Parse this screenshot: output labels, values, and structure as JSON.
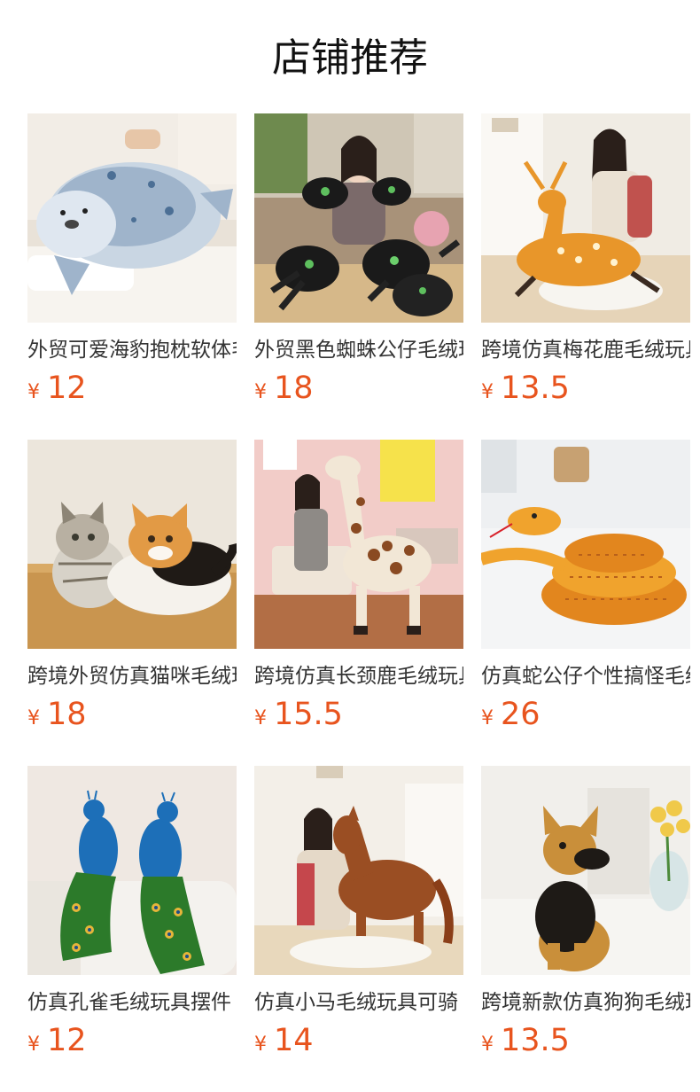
{
  "section": {
    "title": "店铺推荐"
  },
  "products": [
    {
      "name": "外贸可爱海豹抱枕软体毛绒玩具",
      "currency": "¥",
      "price": "12",
      "image": "seal-plush-image"
    },
    {
      "name": "外贸黑色蜘蛛公仔毛绒玩具",
      "currency": "¥",
      "price": "18",
      "image": "spider-plush-image"
    },
    {
      "name": "跨境仿真梅花鹿毛绒玩具",
      "currency": "¥",
      "price": "13.5",
      "image": "deer-plush-image"
    },
    {
      "name": "跨境外贸仿真猫咪毛绒玩具",
      "currency": "¥",
      "price": "18",
      "image": "cat-plush-image"
    },
    {
      "name": "跨境仿真长颈鹿毛绒玩具",
      "currency": "¥",
      "price": "15.5",
      "image": "giraffe-plush-image"
    },
    {
      "name": "仿真蛇公仔个性搞怪毛绒玩具",
      "currency": "¥",
      "price": "26",
      "image": "snake-plush-image"
    },
    {
      "name": "仿真孔雀毛绒玩具摆件",
      "currency": "¥",
      "price": "12",
      "image": "peacock-plush-image"
    },
    {
      "name": "仿真小马毛绒玩具可骑",
      "currency": "¥",
      "price": "14",
      "image": "horse-plush-image"
    },
    {
      "name": "跨境新款仿真狗狗毛绒玩具",
      "currency": "¥",
      "price": "13.5",
      "image": "dog-plush-image"
    }
  ],
  "colors": {
    "price": "#e8541e",
    "title": "#111111",
    "name": "#333333"
  }
}
